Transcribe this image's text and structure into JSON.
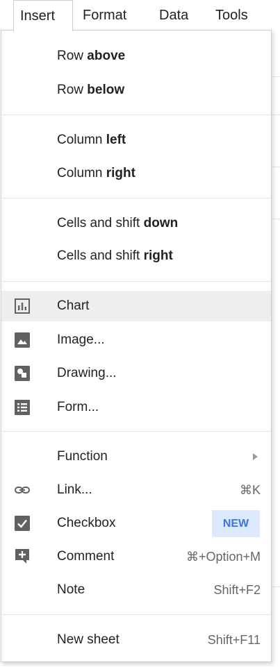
{
  "menubar": {
    "items": [
      "Insert",
      "Format",
      "Data",
      "Tools"
    ],
    "active": "Insert"
  },
  "menu": {
    "row_above": {
      "pre": "Row ",
      "bold": "above"
    },
    "row_below": {
      "pre": "Row ",
      "bold": "below"
    },
    "column_left": {
      "pre": "Column ",
      "bold": "left"
    },
    "column_right": {
      "pre": "Column ",
      "bold": "right"
    },
    "cells_down": {
      "pre": "Cells and shift ",
      "bold": "down"
    },
    "cells_right": {
      "pre": "Cells and shift ",
      "bold": "right"
    },
    "chart": {
      "label": "Chart",
      "icon": "chart-icon"
    },
    "image": {
      "label": "Image...",
      "icon": "image-icon"
    },
    "drawing": {
      "label": "Drawing...",
      "icon": "drawing-icon"
    },
    "form": {
      "label": "Form...",
      "icon": "form-icon"
    },
    "function": {
      "label": "Function",
      "icon": "submenu-arrow-icon"
    },
    "link": {
      "label": "Link...",
      "shortcut": "⌘K",
      "icon": "link-icon"
    },
    "checkbox": {
      "label": "Checkbox",
      "badge": "NEW",
      "icon": "checkbox-icon"
    },
    "comment": {
      "label": "Comment",
      "shortcut": "⌘+Option+M",
      "icon": "comment-icon"
    },
    "note": {
      "label": "Note",
      "shortcut": "Shift+F2"
    },
    "new_sheet": {
      "label": "New sheet",
      "shortcut": "Shift+F11"
    }
  },
  "colors": {
    "highlight": "#eeeeee",
    "badge_bg": "#dce8fc",
    "badge_text": "#3e73e0",
    "icon": "#616161"
  }
}
